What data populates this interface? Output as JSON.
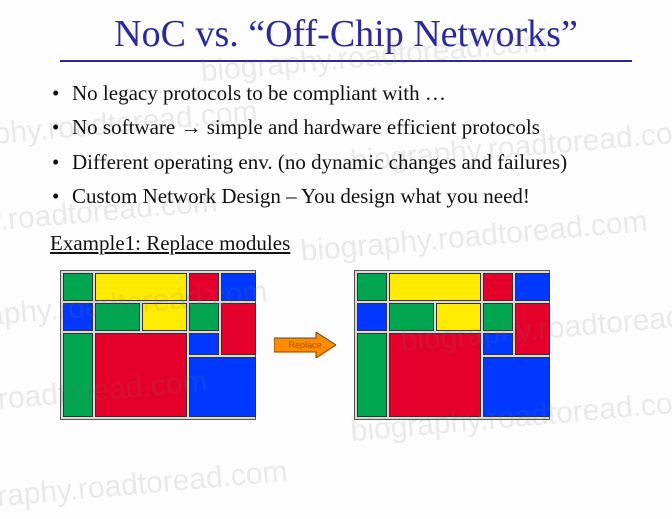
{
  "title": "NoC vs. “Off-Chip Networks”",
  "bullets": [
    "No legacy protocols to be compliant with …",
    "No software → simple and hardware efficient protocols",
    "Different operating env. (no dynamic changes and failures)",
    "Custom Network Design – You design what you need!"
  ],
  "example_label": "Example1: Replace modules",
  "arrow_label": "Replace",
  "watermark_text": "biography.roadtoread.com"
}
